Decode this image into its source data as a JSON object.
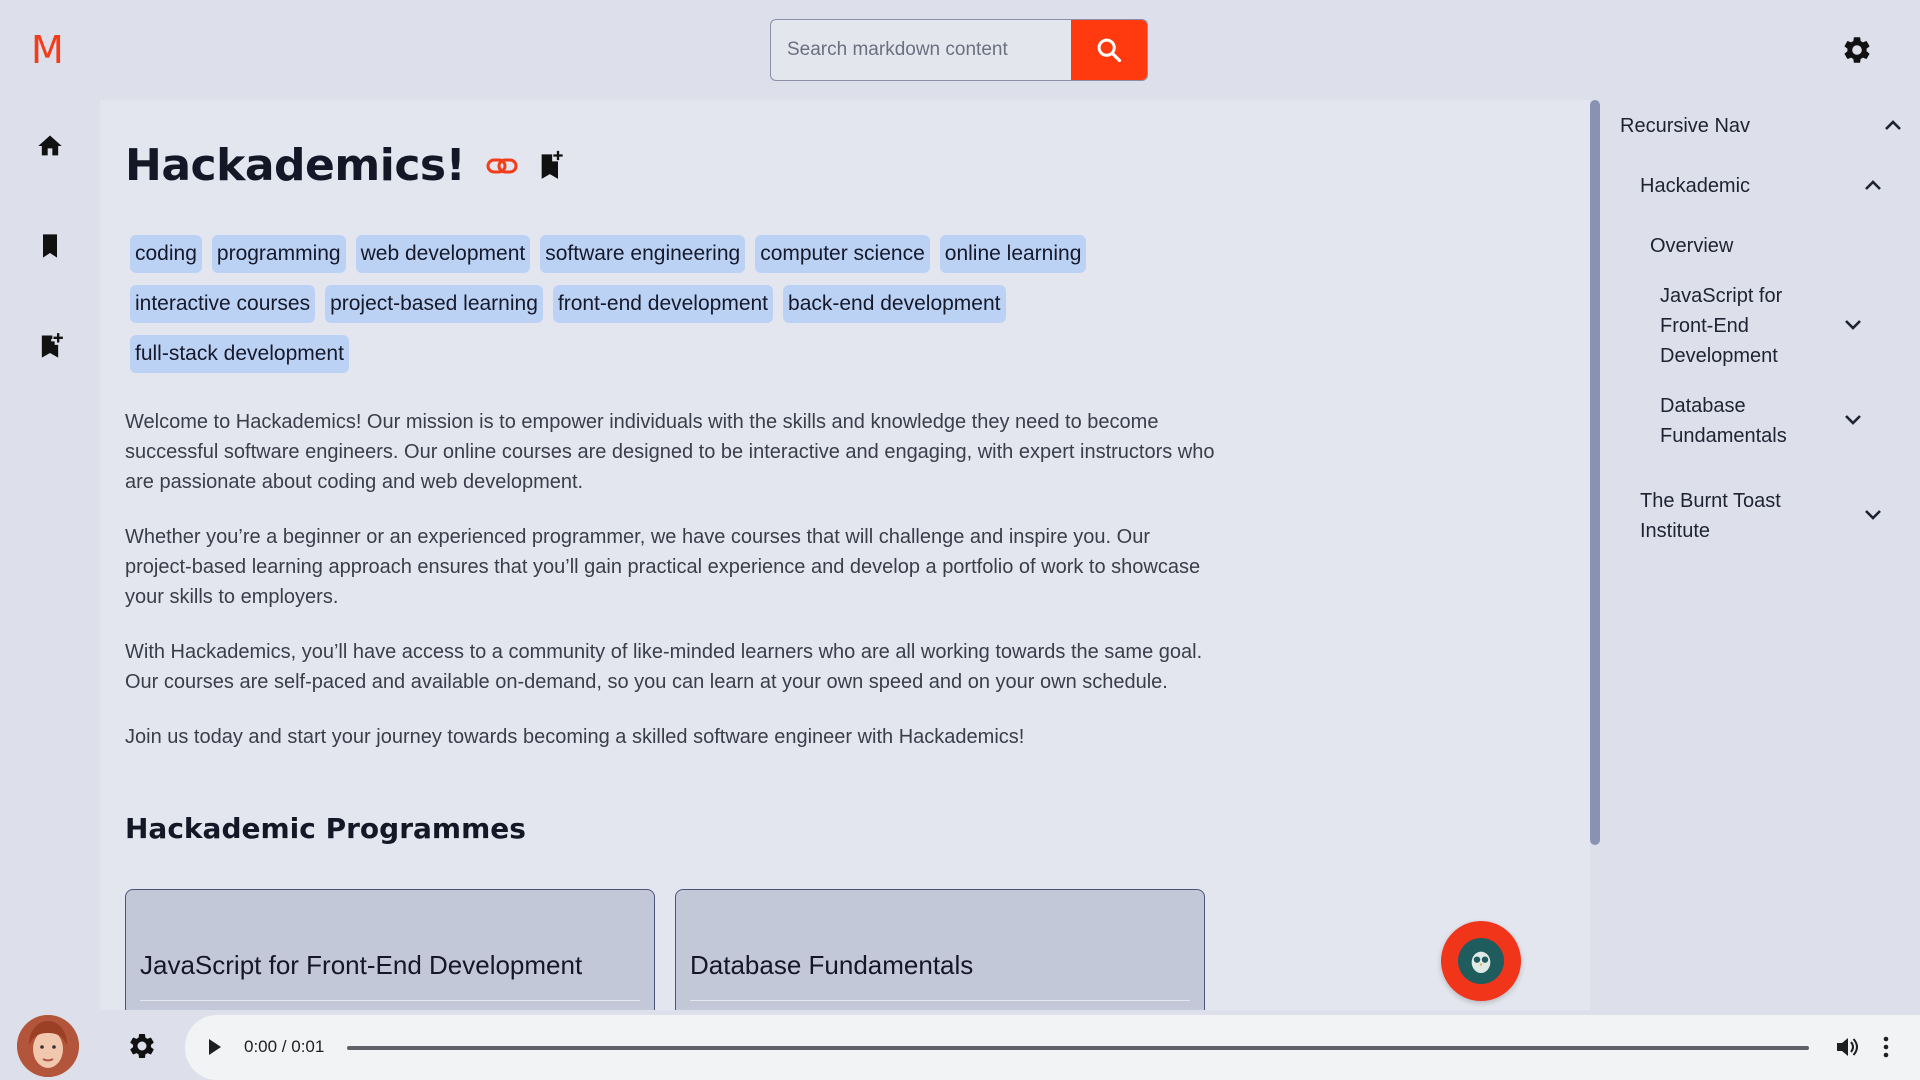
{
  "app": {
    "logo": "M"
  },
  "search": {
    "placeholder": "Search markdown content"
  },
  "page": {
    "title": "Hackademics!",
    "tags": [
      "coding",
      "programming",
      "web development",
      "software engineering",
      "computer science",
      "online learning",
      "interactive courses",
      "project-based learning",
      "front-end development",
      "back-end development",
      "full-stack development"
    ],
    "paragraphs": [
      "Welcome to Hackademics! Our mission is to empower individuals with the skills and knowledge they need to become successful software engineers. Our online courses are designed to be interactive and engaging, with expert instructors who are passionate about coding and web development.",
      "Whether you’re a beginner or an experienced programmer, we have courses that will challenge and inspire you. Our project-based learning approach ensures that you’ll gain practical experience and develop a portfolio of work to showcase your skills to employers.",
      "With Hackademics, you’ll have access to a community of like-minded learners who are all working towards the same goal. Our courses are self-paced and available on-demand, so you can learn at your own speed and on your own schedule.",
      "Join us today and start your journey towards becoming a skilled software engineer with Hackademics!"
    ],
    "section_title": "Hackademic Programmes",
    "cards": [
      "JavaScript for Front-End Development",
      "Database Fundamentals"
    ]
  },
  "rightnav": {
    "root": "Recursive Nav",
    "group": "Hackademic",
    "overview": "Overview",
    "item1": [
      "JavaScript for",
      "Front-End",
      "Development"
    ],
    "item2": [
      "Database",
      "Fundamentals"
    ],
    "item3": [
      "The Burnt Toast",
      "Institute"
    ]
  },
  "player": {
    "time": "0:00 / 0:01",
    "progress": 0
  },
  "colors": {
    "accent": "#ff3a0f",
    "tag_bg": "#bcd2f5",
    "scrollbar": "#8a92b4"
  },
  "icons": [
    "home-icon",
    "bookmark-icon",
    "bookmark-add-icon",
    "link-icon",
    "search-icon",
    "gear-icon",
    "chevron-up-icon",
    "chevron-down-icon",
    "play-icon",
    "volume-icon",
    "more-vert-icon"
  ]
}
